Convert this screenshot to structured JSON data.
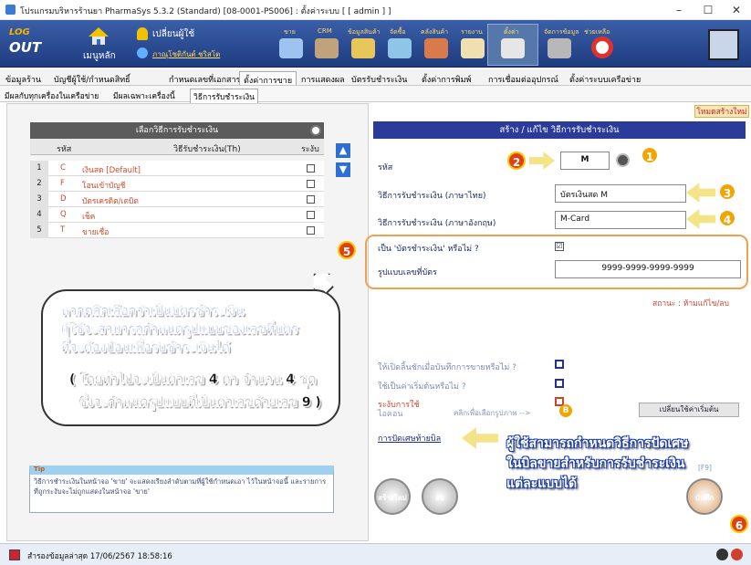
{
  "window": {
    "title": "โปรแกรมบริหารร้านยา PharmaSys 5.3.2 (Standard) [08-0001-PS006] : ตั้งค่าระบบ [ [ admin ] ]",
    "min": "–",
    "max": "☐",
    "close": "✕"
  },
  "toolbar": {
    "logo_top": "LOG",
    "logo_bottom": "OUT",
    "main_menu": "เมนูหลัก",
    "switch_user": "เปลี่ยนผู้ใช้",
    "user_name": "ภาณุโชติกันต์ ชริสโต",
    "items": [
      "ขาย",
      "CRM",
      "ข้อมูลสินค้า",
      "จัดซื้อ",
      "คลังสินค้า",
      "รายงาน",
      "ตั้งค่า",
      "จัดการข้อมูล",
      "ช่วยเหลือ"
    ]
  },
  "tabs1": [
    "ข้อมูลร้าน",
    "บัญชีผู้ใช้/กำหนดสิทธิ์",
    "กำหนดเลขที่เอกสาร",
    "ตั้งค่าการขาย",
    "การแสดงผล",
    "บัตรรับชำระเงิน",
    "ตั้งค่าการพิมพ์",
    "การเชื่อมต่ออุปกรณ์",
    "ตั้งค่าระบบเครือข่าย"
  ],
  "tabs2": [
    "มีผลกับทุกเครื่องในเครือข่าย",
    "มีผลเฉพาะเครื่องนี้",
    "วิธีการรับชำระเงิน"
  ],
  "grid": {
    "title": "เลือกวิธีการรับชำระเงิน",
    "columns": [
      "รหัส",
      "วิธีรับชำระเงิน(Th)",
      "ระงับ"
    ],
    "rows": [
      {
        "n": "1",
        "code": "C",
        "name": "เงินสด [Default]"
      },
      {
        "n": "2",
        "code": "F",
        "name": "โอนเข้าบัญชี"
      },
      {
        "n": "3",
        "code": "D",
        "name": "บัตรเครดิต/เดบิต"
      },
      {
        "n": "4",
        "code": "Q",
        "name": "เช็ค"
      },
      {
        "n": "5",
        "code": "T",
        "name": "ขายเชื่อ"
      }
    ]
  },
  "form": {
    "mode_button": "โหมดสร้างใหม่",
    "header": "สร้าง / แก้ไข วิธีการรับชำระเงิน",
    "code_label": "รหัส",
    "code_value": "M",
    "thai_label": "วิธีการรับชำระเงิน (ภาษาไทย)",
    "thai_value": "บัตรเงินสด M",
    "eng_label": "วิธีการรับชำระเงิน (ภาษาอังกฤษ)",
    "eng_value": "M-Card",
    "is_card_label": "เป็น 'บัตรชำระเงิน' หรือไม่ ?",
    "card_format_label": "รูปแบบเลขที่บัตร",
    "card_format_value": "9999-9999-9999-9999",
    "status": "สถานะ : ห้ามแก้ไข/ลบ",
    "drawer_label": "ให้เปิดลิ้นชักเมื่อบันทึกการขายหรือไม่ ?",
    "default_label": "ใช้เป็นค่าเริ่มต้นหรือไม่ ?",
    "suspend_label": "ระงับการใช้",
    "icon_label": "ไอคอน",
    "icon_hint": "คลิกเพื่อเลือกรูปภาพ -->",
    "fetch_default": "เปลี่ยนใช้ค่าเริ่มต้น",
    "rounding": "การปัดเศษท้ายบิล",
    "save_shortcut": "[F9]"
  },
  "callouts": {
    "bubble_1": "1",
    "bubble_2": "2",
    "bubble_3": "3",
    "bubble_4": "4",
    "bubble_5": "5",
    "bubble_6": "6",
    "c1_line1": "หากคลิกเลือกว่าเป็นบัตรชำระเงิน",
    "c1_line2": "ผู้ใช้จะสามารถกำหนดรูปแบบของเลขที่บัตร",
    "c1_line3": "ที่จะต้องป้อนเมื่อรับชำระเงินได้",
    "c1_line4": "( โดยทั่วไปจะเป็นตัวเลข 4 ตัว จำนวน 4 ชุด",
    "c1_line5": "ซึ่งจะกำหนดรูปแบบที่เป็นตัวเลขด้วยเลข 9 )",
    "c2_line1": "ผู้ใช้สามารถกำหนดวิธีการปัดเศษ",
    "c2_line2": "ในบิลขายสำหรับการรับชำระเงิน",
    "c2_line3": "แต่ละแบบได้"
  },
  "tip": {
    "label": "Tip",
    "text": "วิธีการชำระเงินในหน้าจอ 'ขาย' จะแสดงเรียงลำดับตามที่ผู้ใช้กำหนดเอา ไว้ในหน้าจอนี้ และรายการที่ถูกระงับจะไม่ถูกแสดงในหน้าจอ 'ขาย'"
  },
  "buttons": {
    "new": "สร้างใหม่",
    "delete": "ลบ",
    "save": "บันทึก"
  },
  "statusbar": {
    "text": "สำรองข้อมูลล่าสุด 17/06/2567 18:58:16"
  }
}
